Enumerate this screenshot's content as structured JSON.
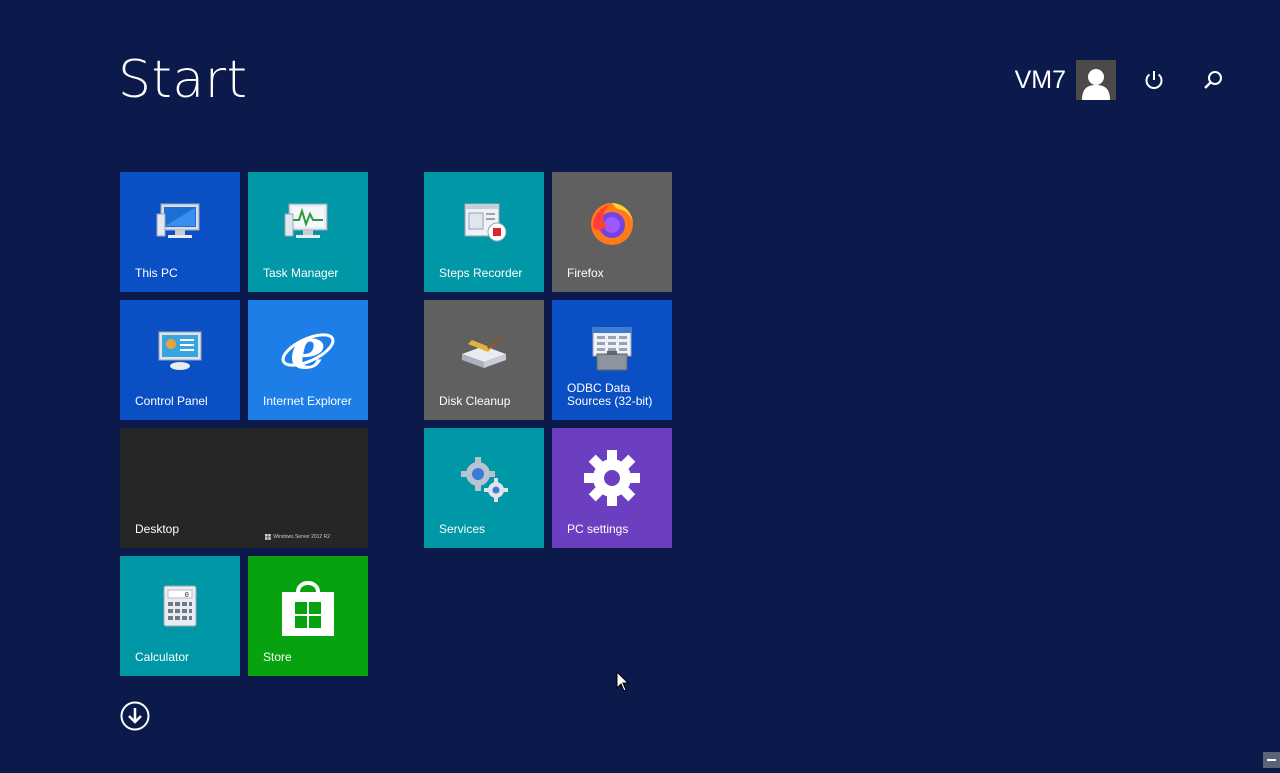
{
  "header": {
    "title": "Start",
    "user_name": "VM7"
  },
  "colors": {
    "background": "#0b1a4b",
    "blue": "#0a4fc4",
    "teal": "#0097a7",
    "gray": "#606060",
    "ie_blue": "#1d7ee8",
    "dark": "#262626",
    "purple": "#6b3fbf",
    "green": "#07a20f"
  },
  "tiles": {
    "this_pc": {
      "label": "This PC",
      "icon": "computer-icon"
    },
    "task_manager": {
      "label": "Task Manager",
      "icon": "task-manager-icon"
    },
    "steps_recorder": {
      "label": "Steps Recorder",
      "icon": "steps-recorder-icon"
    },
    "firefox": {
      "label": "Firefox",
      "icon": "firefox-icon"
    },
    "control_panel": {
      "label": "Control Panel",
      "icon": "control-panel-icon"
    },
    "internet_explorer": {
      "label": "Internet Explorer",
      "icon": "internet-explorer-icon"
    },
    "disk_cleanup": {
      "label": "Disk Cleanup",
      "icon": "disk-cleanup-icon"
    },
    "odbc": {
      "label_line1": "ODBC Data",
      "label_line2": "Sources (32-bit)",
      "icon": "odbc-icon"
    },
    "desktop": {
      "label": "Desktop",
      "watermark": "Windows Server 2012 R2"
    },
    "services": {
      "label": "Services",
      "icon": "services-gears-icon"
    },
    "pc_settings": {
      "label": "PC settings",
      "icon": "settings-gear-icon"
    },
    "calculator": {
      "label": "Calculator",
      "icon": "calculator-icon"
    },
    "store": {
      "label": "Store",
      "icon": "store-bag-icon"
    }
  },
  "controls": {
    "power_icon": "power-icon",
    "search_icon": "search-icon",
    "all_apps_icon": "arrow-down-circle-icon"
  }
}
